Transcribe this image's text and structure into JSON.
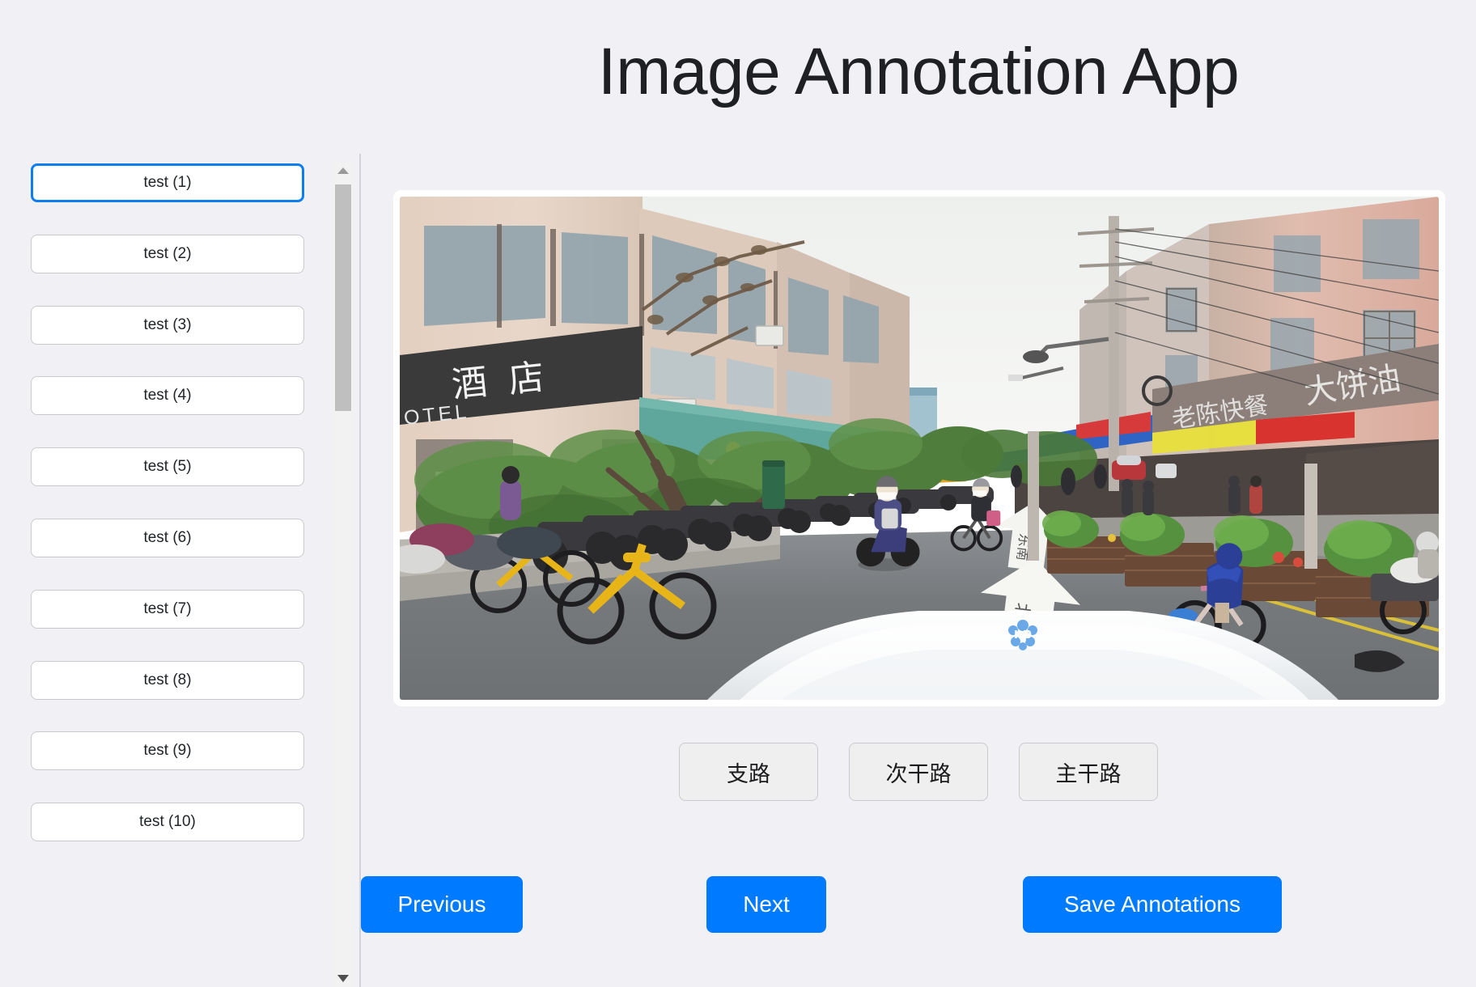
{
  "header": {
    "title": "Image Annotation App"
  },
  "sidebar": {
    "scroll_up_icon": "triangle-up-icon",
    "scroll_down_icon": "triangle-down-icon",
    "items": [
      {
        "label": "test (1)",
        "selected": true
      },
      {
        "label": "test (2)",
        "selected": false
      },
      {
        "label": "test (3)",
        "selected": false
      },
      {
        "label": "test (4)",
        "selected": false
      },
      {
        "label": "test (5)",
        "selected": false
      },
      {
        "label": "test (6)",
        "selected": false
      },
      {
        "label": "test (7)",
        "selected": false
      },
      {
        "label": "test (8)",
        "selected": false
      },
      {
        "label": "test (9)",
        "selected": false
      },
      {
        "label": "test (10)",
        "selected": false
      }
    ]
  },
  "image_panel": {
    "scene_description": "Street-level dashcam view of an urban Chinese street: motorbikes parked along the left sidewalk beside a hotel, shops with signboards on the right, cyclists and scooters on the roadway, directional arrows painted on the asphalt, white vehicle hood in the foreground.",
    "signs": {
      "hotel_cn": "酒店",
      "hotel_en": "OTEL",
      "shop_fastfood": "老陈快餐",
      "shop_pancake": "大饼油",
      "road_arrow_1": "东南",
      "road_arrow_2": "北"
    }
  },
  "labels": {
    "buttons": [
      {
        "label": "支路"
      },
      {
        "label": "次干路"
      },
      {
        "label": "主干路"
      }
    ]
  },
  "actions": {
    "previous": "Previous",
    "next": "Next",
    "save": "Save Annotations"
  },
  "colors": {
    "background": "#f1f0f5",
    "accent_blue": "#007bff",
    "selected_border": "#0d7ef0",
    "card_white": "#ffffff",
    "label_button_bg": "#efeff0",
    "border_grey": "#c9c9cf"
  }
}
